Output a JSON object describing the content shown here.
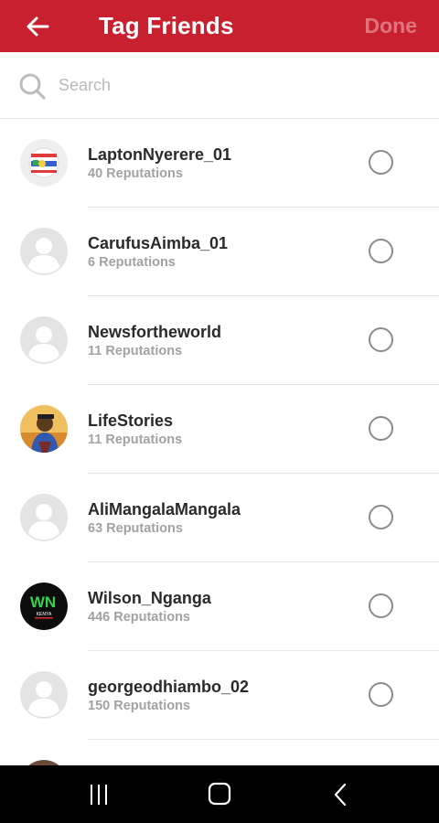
{
  "header": {
    "title": "Tag Friends",
    "done_label": "Done",
    "back_icon": "arrow-left-icon"
  },
  "search": {
    "placeholder": "Search",
    "icon": "search-icon"
  },
  "friends": [
    {
      "name": "LaptonNyerere_01",
      "reputations": "40 Reputations",
      "avatar": "flag-logo"
    },
    {
      "name": "CarufusAimba_01",
      "reputations": "6 Reputations",
      "avatar": "default"
    },
    {
      "name": "Newsfortheworld",
      "reputations": "11 Reputations",
      "avatar": "default"
    },
    {
      "name": "LifeStories",
      "reputations": "11 Reputations",
      "avatar": "photo"
    },
    {
      "name": "AliMangalaMangala",
      "reputations": "63 Reputations",
      "avatar": "default"
    },
    {
      "name": "Wilson_Nganga",
      "reputations": "446 Reputations",
      "avatar": "wn-logo"
    },
    {
      "name": "georgeodhiambo_02",
      "reputations": "150 Reputations",
      "avatar": "default"
    }
  ],
  "logo_texts": {
    "wn": "WN",
    "wn_sub": "KENYA"
  },
  "navbar": {
    "recents": "recents-icon",
    "home": "home-icon",
    "back": "back-icon"
  },
  "colors": {
    "header_bg": "#c8202f",
    "done_disabled": "#e0747d",
    "placeholder": "#b9b9b9",
    "name": "#2a2a2a",
    "reputations": "#a2a2a2"
  }
}
